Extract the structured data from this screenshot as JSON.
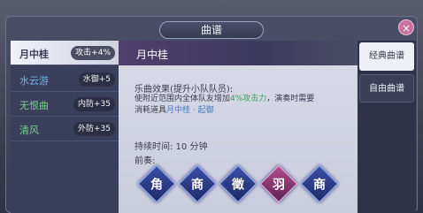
{
  "window": {
    "title": "曲谱",
    "close_label": "×"
  },
  "sidebar": {
    "items": [
      {
        "name": "月中桂",
        "stat": "攻击+4%",
        "name_color": "#3c3f58",
        "active": true
      },
      {
        "name": "水云游",
        "stat": "水御+5",
        "name_color": "#6fb2e4"
      },
      {
        "name": "无恨曲",
        "stat": "内防+35",
        "name_color": "#77d28d"
      },
      {
        "name": "清风",
        "stat": "外防+35",
        "name_color": "#77d28d"
      }
    ]
  },
  "detail": {
    "title": "月中桂",
    "effect_title": "乐曲效果(提升小队队员):",
    "effect_desc_1": "使附近范围内全体队友增加",
    "effect_highlight": "4%攻击力",
    "effect_desc_2": "，演奏时需要",
    "effect_desc_3": "消耗道具",
    "effect_item": "月中桂 · 起御",
    "duration": "持续时间: 10 分钟",
    "prelude_label": "前奏:",
    "notes": [
      {
        "char": "角",
        "color": "blue"
      },
      {
        "char": "商",
        "color": "blue"
      },
      {
        "char": "徵",
        "color": "blue"
      },
      {
        "char": "羽",
        "color": "pink"
      },
      {
        "char": "商",
        "color": "blue"
      }
    ]
  },
  "tabs": [
    {
      "label": "经典曲谱",
      "active": true
    },
    {
      "label": "自由曲谱",
      "active": false
    }
  ],
  "colors": {
    "highlight_green": "#36a35a",
    "highlight_blue": "#4277c6",
    "note_blue": "#2b3b88",
    "note_pink": "#b14b8c"
  }
}
